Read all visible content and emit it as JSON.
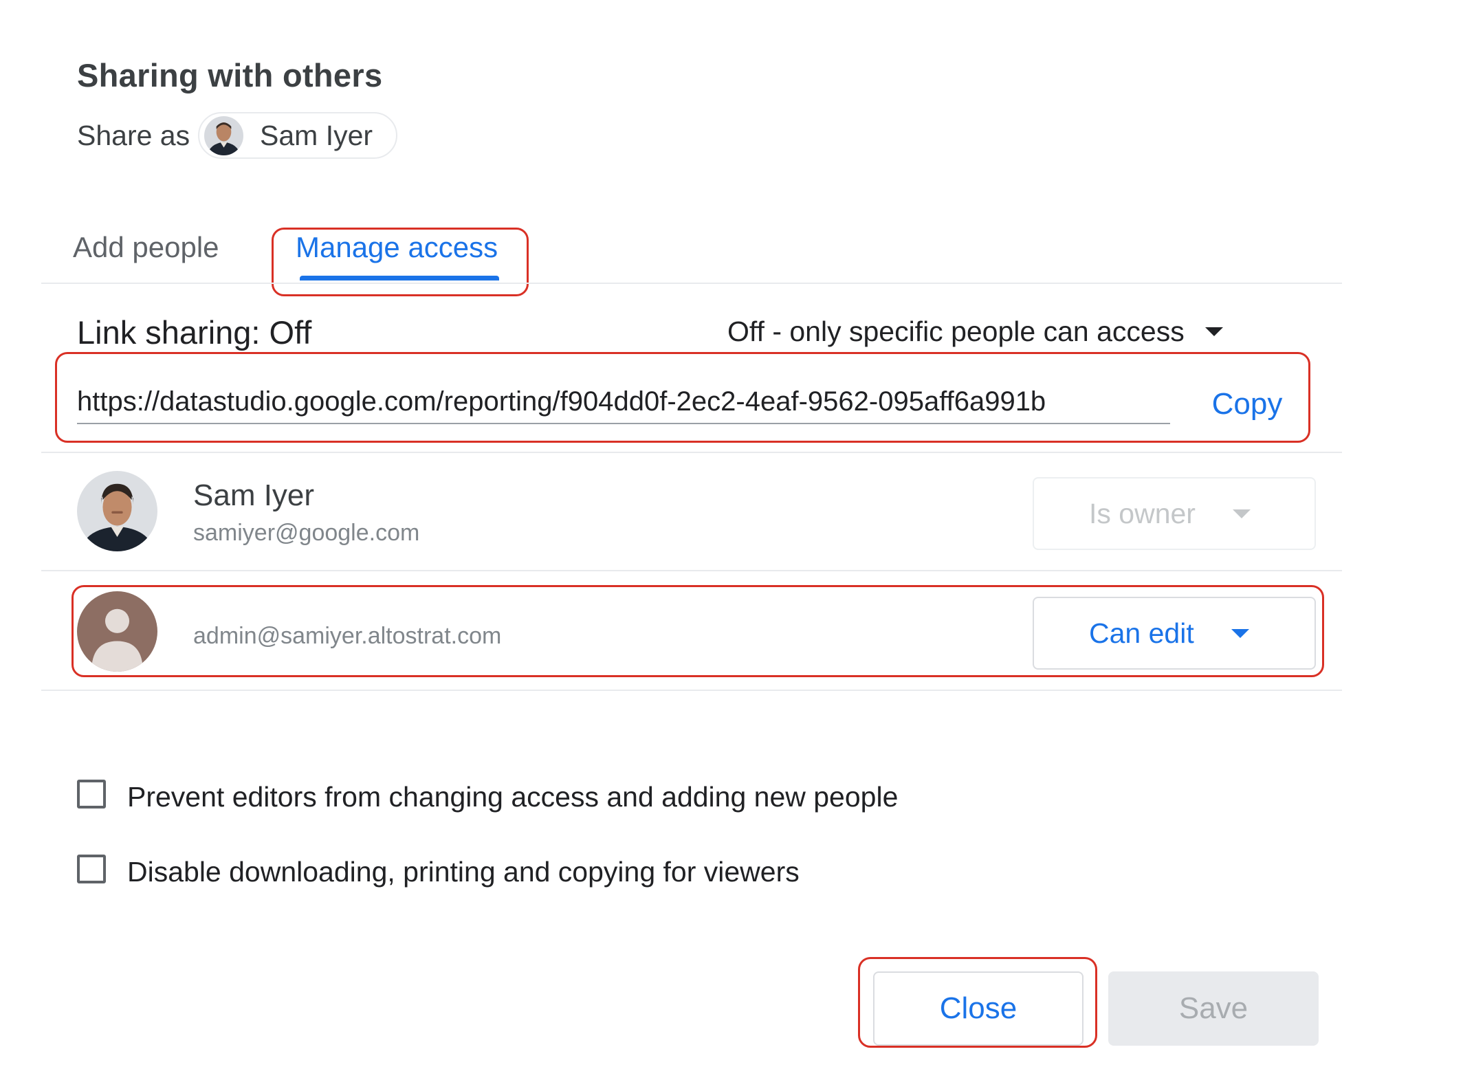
{
  "dialog": {
    "title": "Sharing with others",
    "share_as_label": "Share as",
    "share_as_name": "Sam Iyer"
  },
  "tabs": [
    {
      "label": "Add people",
      "active": false
    },
    {
      "label": "Manage access",
      "active": true
    }
  ],
  "link_sharing": {
    "label": "Link sharing: Off",
    "mode": "Off - only specific people can access",
    "url": "https://datastudio.google.com/reporting/f904dd0f-2ec2-4eaf-9562-095aff6a991b",
    "copy_label": "Copy"
  },
  "people": [
    {
      "name": "Sam Iyer",
      "email": "samiyer@google.com",
      "role": "Is owner",
      "role_enabled": false
    },
    {
      "name": "",
      "email": "admin@samiyer.altostrat.com",
      "role": "Can edit",
      "role_enabled": true
    }
  ],
  "options": [
    {
      "label": "Prevent editors from changing access and adding new people",
      "checked": false
    },
    {
      "label": "Disable downloading, printing and copying for viewers",
      "checked": false
    }
  ],
  "buttons": {
    "close_label": "Close",
    "save_label": "Save"
  },
  "colors": {
    "accent": "#1a73e8",
    "highlight_box": "#d93025",
    "disabled_text": "#a8acb0"
  },
  "icons": {
    "owner_avatar": "profile-photo",
    "admin_avatar": "default-person-avatar",
    "dropdown": "caret-down-icon"
  }
}
